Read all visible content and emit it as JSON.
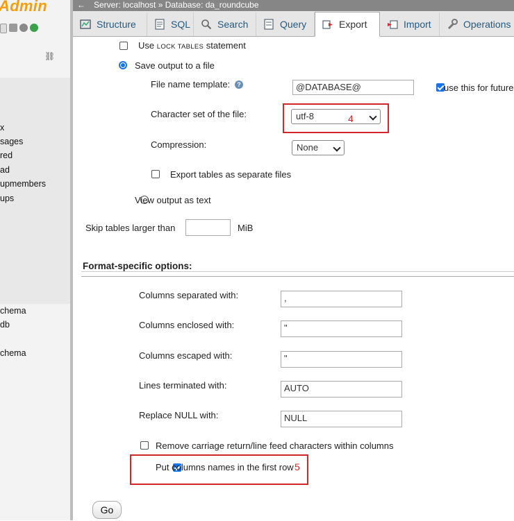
{
  "app": {
    "logo_text": "Admin"
  },
  "sidebar": {
    "databases": [
      "x",
      "sages",
      "red",
      "ad",
      "upmembers",
      "ups"
    ],
    "databases_lower": [
      "chema",
      "db",
      "chema"
    ]
  },
  "topbar": {
    "back": "←",
    "crumb": "Server: localhost » Database: da_roundcube"
  },
  "tabs": [
    {
      "label": "Structure",
      "icon": "structure-icon"
    },
    {
      "label": "SQL",
      "icon": "sql-icon"
    },
    {
      "label": "Search",
      "icon": "search-icon"
    },
    {
      "label": "Query",
      "icon": "query-icon"
    },
    {
      "label": "Export",
      "icon": "export-icon",
      "active": true
    },
    {
      "label": "Import",
      "icon": "import-icon"
    },
    {
      "label": "Operations",
      "icon": "wrench-icon"
    }
  ],
  "output": {
    "lock_tables": {
      "prefix": "Use ",
      "small": "LOCK TABLES",
      "suffix": " statement",
      "checked": false
    },
    "save_to_file": {
      "label": "Save output to a file",
      "checked": true
    },
    "file_name_template": {
      "label": "File name template:",
      "value": "@DATABASE@"
    },
    "use_for_future": {
      "label": "use this for future",
      "checked": true
    },
    "charset": {
      "label": "Character set of the file:",
      "value": "utf-8",
      "annotation": "4"
    },
    "compression": {
      "label": "Compression:",
      "value": "None"
    },
    "separate_files": {
      "label": "Export tables as separate files",
      "checked": false
    },
    "view_as_text": {
      "label": "View output as text",
      "checked": false
    },
    "skip_tables": {
      "label": "Skip tables larger than",
      "value": "",
      "unit": "MiB"
    }
  },
  "format": {
    "heading": "Format-specific options:",
    "fields": [
      {
        "label": "Columns separated with:",
        "value": ","
      },
      {
        "label": "Columns enclosed with:",
        "value": "\""
      },
      {
        "label": "Columns escaped with:",
        "value": "\""
      },
      {
        "label": "Lines terminated with:",
        "value": "AUTO"
      },
      {
        "label": "Replace NULL with:",
        "value": "NULL"
      }
    ],
    "remove_crlf": {
      "label": "Remove carriage return/line feed characters within columns",
      "checked": false
    },
    "column_names": {
      "label": "Put columns names in the first row",
      "checked": true,
      "annotation": "5"
    }
  },
  "actions": {
    "go_label": "Go"
  },
  "colors": {
    "accent": "#1a73e8",
    "annotation_red": "#d3262b",
    "logo_orange": "#f29e0e",
    "tab_link": "#235a81"
  }
}
